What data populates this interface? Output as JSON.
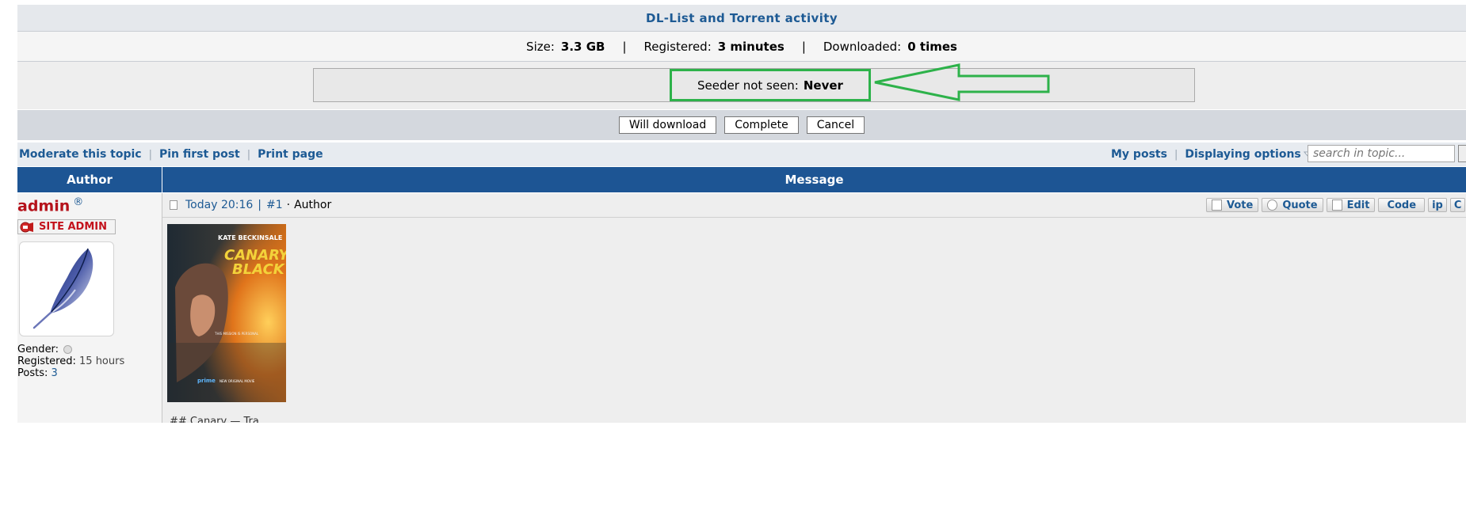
{
  "dl_section": {
    "title": "DL-List and Torrent activity",
    "size_label": "Size:",
    "size_value": "3.3 GB",
    "registered_label": "Registered:",
    "registered_value": "3 minutes",
    "downloaded_label": "Downloaded:",
    "downloaded_value": "0 times",
    "separator": "|",
    "seeder_label": "Seeder not seen:",
    "seeder_value": "Never",
    "annotation_color": "#2db24a",
    "buttons": {
      "will_download": "Will download",
      "complete": "Complete",
      "cancel": "Cancel"
    }
  },
  "toolbar": {
    "moderate": "Moderate this topic",
    "pin": "Pin first post",
    "print": "Print page",
    "my_posts": "My posts",
    "display_options": "Displaying options",
    "search_placeholder": "search in topic...",
    "separator": "|"
  },
  "table": {
    "author_header": "Author",
    "message_header": "Message",
    "header_color": "#1d5594"
  },
  "author": {
    "name": "admin",
    "mark": "®",
    "rank": "SITE ADMIN",
    "gender_label": "Gender:",
    "registered_label": "Registered:",
    "registered_value": "15 hours",
    "posts_label": "Posts:",
    "posts_value": "3",
    "avatar_icon": "feather-icon"
  },
  "post": {
    "time": "Today 20:16",
    "separator": "|",
    "number": "#1",
    "dot": "·",
    "author_tag": "Author",
    "buttons": {
      "vote": "Vote",
      "quote": "Quote",
      "edit": "Edit",
      "code": "Code",
      "ip": "ip",
      "c": "C"
    },
    "poster": {
      "actor": "KATE BECKINSALE",
      "title_line1": "CANARY",
      "title_line2": "BLACK",
      "tagline": "THIS MISSION IS PERSONAL",
      "brand": "prime",
      "footer": "NEW ORIGINAL MOVIE"
    },
    "cutoff_text": "## Canary — Tra..."
  }
}
